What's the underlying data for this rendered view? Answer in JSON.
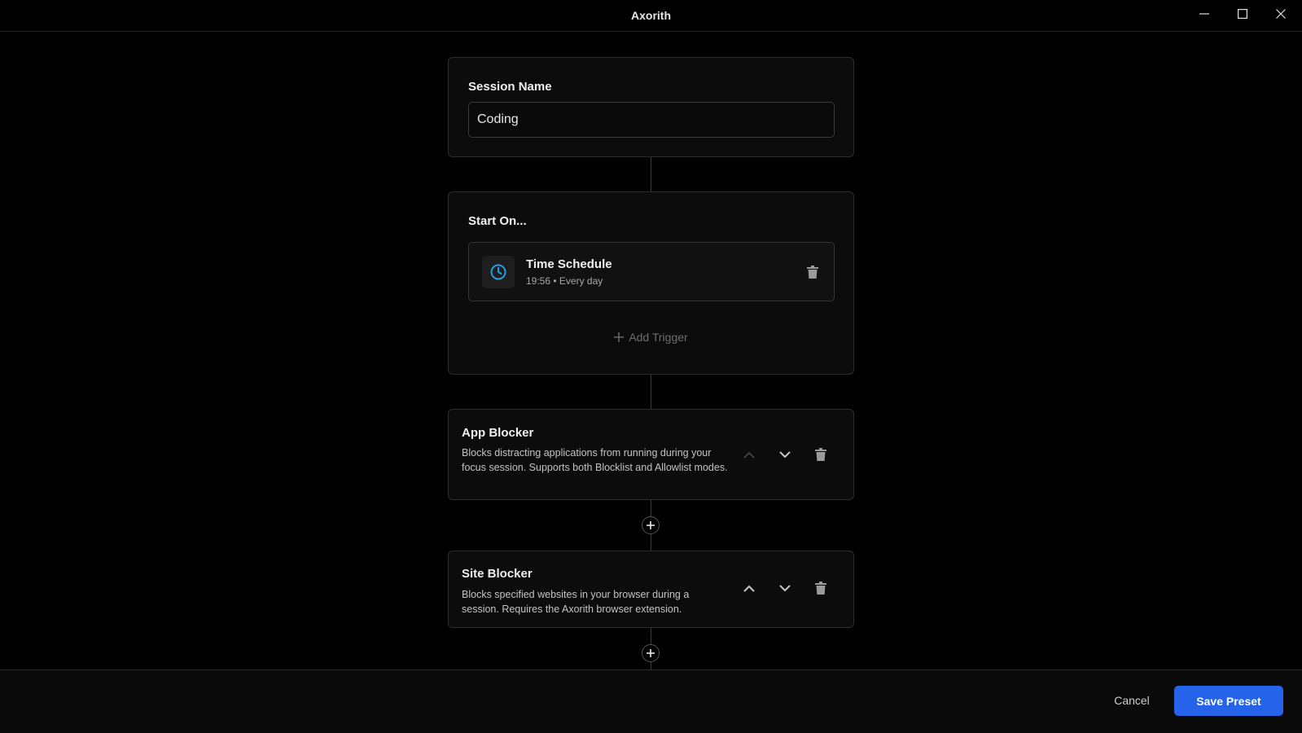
{
  "window": {
    "title": "Axorith",
    "controls": [
      "minimize-icon",
      "maximize-icon",
      "close-icon"
    ]
  },
  "session": {
    "label": "Session Name",
    "value": "Coding"
  },
  "start_on": {
    "title": "Start On...",
    "trigger": {
      "icon": "clock-icon",
      "title": "Time Schedule",
      "subtitle": "19:56 • Every day"
    },
    "add_trigger_label": "Add Trigger"
  },
  "modules": [
    {
      "title": "App Blocker",
      "description": "Blocks distracting applications from running during your focus session. Supports both Blocklist and Allowlist modes.",
      "move_up_enabled": false
    },
    {
      "title": "Site Blocker",
      "description": "Blocks specified websites in your browser during a session. Requires the Axorith browser extension.",
      "move_up_enabled": true
    }
  ],
  "footer": {
    "cancel_label": "Cancel",
    "save_label": "Save Preset"
  },
  "colors": {
    "accent": "#2563eb",
    "clock": "#1ea0e0"
  }
}
